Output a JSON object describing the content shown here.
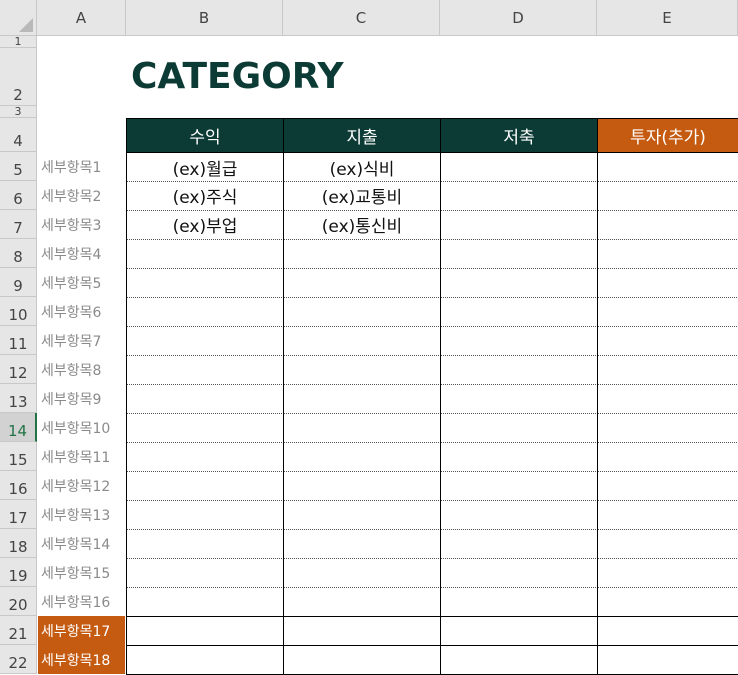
{
  "spreadsheet": {
    "columns": [
      "A",
      "B",
      "C",
      "D",
      "E"
    ],
    "rows": [
      "1",
      "2",
      "3",
      "4",
      "5",
      "6",
      "7",
      "8",
      "9",
      "10",
      "11",
      "12",
      "13",
      "14",
      "15",
      "16",
      "17",
      "18",
      "19",
      "20",
      "21",
      "22"
    ],
    "active_row": "14",
    "title": "CATEGORY",
    "headers": [
      "수익",
      "지출",
      "저축",
      "투자(추가)"
    ],
    "header_colors": [
      "#0c3b35",
      "#0c3b35",
      "#0c3b35",
      "#c55a11"
    ],
    "labels": [
      "세부항목1",
      "세부항목2",
      "세부항목3",
      "세부항목4",
      "세부항목5",
      "세부항목6",
      "세부항목7",
      "세부항목8",
      "세부항목9",
      "세부항목10",
      "세부항목11",
      "세부항목12",
      "세부항목13",
      "세부항목14",
      "세부항목15",
      "세부항목16",
      "세부항목17",
      "세부항목18"
    ],
    "highlighted_labels": [
      "세부항목17",
      "세부항목18"
    ],
    "income": [
      "(ex)월급",
      "(ex)주식",
      "(ex)부업"
    ],
    "expense": [
      "(ex)식비",
      "(ex)교통비",
      "(ex)통신비"
    ]
  }
}
